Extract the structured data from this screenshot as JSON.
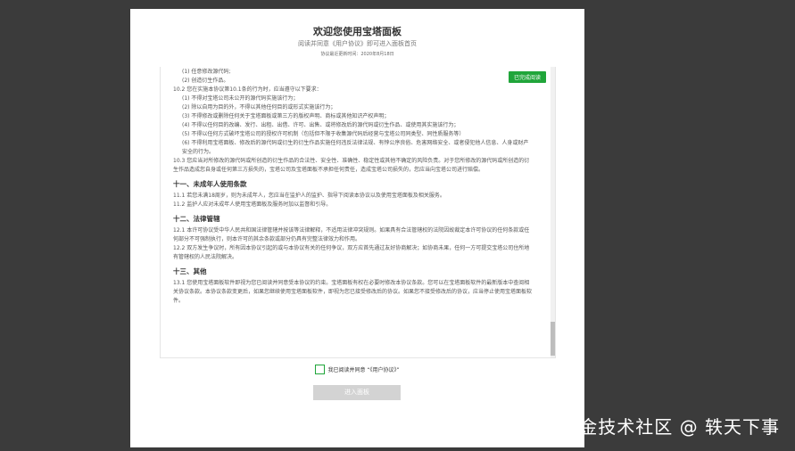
{
  "dialog": {
    "title": "欢迎您使用宝塔面板",
    "subtitle": "阅读并同意《用户协议》即可进入面板首页",
    "updated": "协议最近更新时间：2020年8月18日",
    "read_badge": "已完成阅读"
  },
  "agreement": {
    "top_items": [
      "(1) 任意修改源代码;",
      "(2) 创造衍生作品。"
    ],
    "p10_2": "10.2 您在实施本协议第10.1条的行为时，应当遵守以下要求：",
    "p10_2_items": [
      "(1) 不得对宝塔公司未公开的源代码实施该行为；",
      "(2) 除以自用为目的外，不得以其他任何目的或形式实施该行为；",
      "(3) 不得修改或删除任何关于宝塔面板或第三方的版权声明、商标或其他知识产权声明；",
      "(4) 不得以任何目的改编、发行、出租、出借、许可、出售、或将修改后的源代码或衍生作品、或使用其实施该行为；",
      "(5) 不得以任何方式破坏宝塔公司的授权许可机制（包括但不限于收集源代码后经营与宝塔公司同类型、同性质服务等）",
      "(6) 不得利用宝塔面板、修改后的源代码或衍生的衍生作品实施任何违反法律法规、有悖公序良俗、危害网络安全、或者侵犯他人信息、人身或财产安全的行为。"
    ],
    "p10_3": "10.3 您应当对所修改的源代码或所创造的衍生作品的合法性、安全性、准确性、稳定性或其他不确定的风险负责。对于您所修改的源代码或所创造的衍生作品造成您自身或任何第三方损失的，宝塔公司及宝塔面板不承担任何责任，造成宝塔公司损失的，您应当向宝塔公司进行赔偿。",
    "s11_title": "十一、未成年人使用条款",
    "s11_1": "11.1 若您未满18周岁，则为未成年人，您应当在监护人的监护、指导下阅读本协议以及使用宝塔面板及相关服务。",
    "s11_2": "11.2 监护人应对未成年人使用宝塔面板及服务时加以监督和引导。",
    "s12_title": "十二、法律管辖",
    "s12_1": "12.1 本许可协议受中华人民共和国法律管辖并按该等法律解释，不适用法律冲突规则。如果具有合法管辖权的法院因故裁定本许可协议的任何条款或任何部分不可强制执行，则本许可的其余条款或部分仍具有完整法律效力和作用。",
    "s12_2": "12.2 双方发生争议时，所有因本协议引起的或与本协议有关的任何争议，双方应首先通过友好协商解决；如协商未果，任何一方可提交宝塔公司住所地有管辖权的人民法院解决。",
    "s13_title": "十三、其他",
    "s13_1": "13.1 您使用宝塔面板软件即视为您已阅读并同意受本协议的约束。宝塔面板有权在必要时修改本协议条款。您可以在宝塔面板软件的最新版本中查阅相关协议条款。本协议条款变更后，如果您继续使用宝塔面板软件，即视为您已接受修改后的协议。如果您不接受修改后的协议，应当停止使用宝塔面板软件。"
  },
  "footer": {
    "agree_label": "我已阅读并同意 “《用户协议》”",
    "enter_button": "进入面板"
  },
  "watermark": "掘金技术社区 @ 轶天下事"
}
